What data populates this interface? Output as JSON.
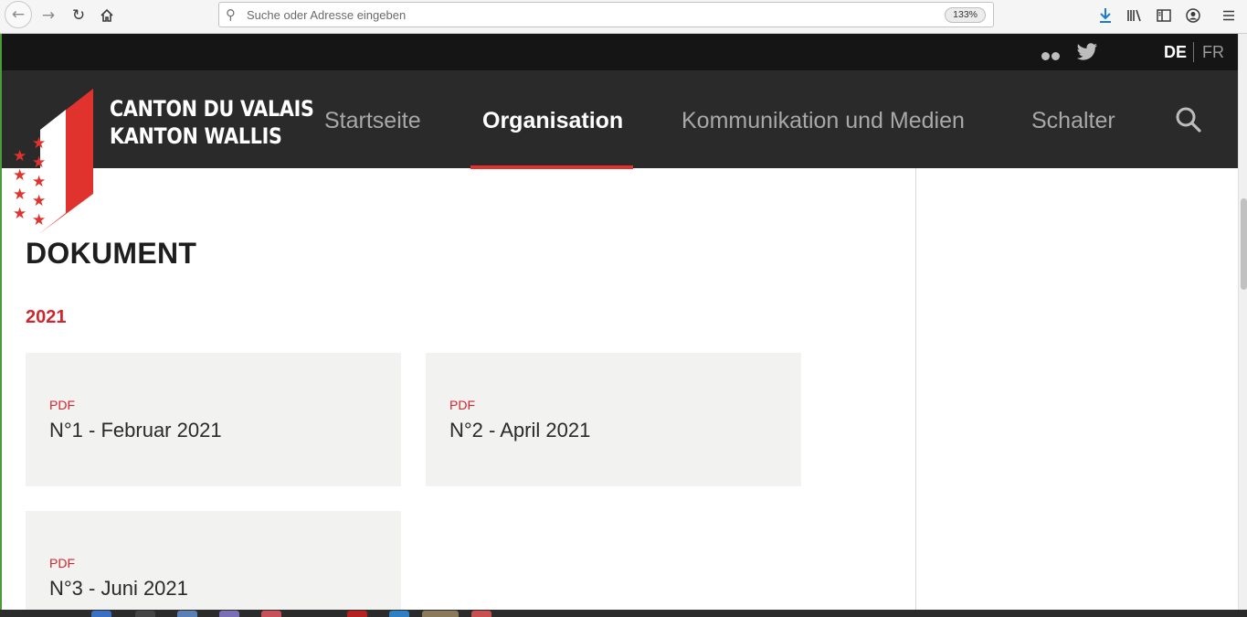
{
  "browser": {
    "url_placeholder": "Suche oder Adresse eingeben",
    "zoom": "133%",
    "icons": [
      "back-icon",
      "forward-icon",
      "reload-icon",
      "home-icon",
      "search-icon",
      "download-icon",
      "library-icon",
      "sidebar-icon",
      "account-icon",
      "menu-icon"
    ]
  },
  "site": {
    "topbar": {
      "social_icons": [
        "flickr-icon",
        "twitter-icon"
      ],
      "lang_active": "DE",
      "lang_other": "FR"
    },
    "logo": {
      "line1": "CANTON DU VALAIS",
      "line2": "KANTON WALLIS"
    },
    "nav": {
      "items": [
        "Startseite",
        "Organisation",
        "Kommunikation und Medien",
        "Schalter"
      ],
      "active": "Organisation"
    },
    "main": {
      "title": "DOKUMENT",
      "year": "2021",
      "documents": [
        {
          "type": "PDF",
          "title": "N°1 - Februar 2021"
        },
        {
          "type": "PDF",
          "title": "N°2 - April 2021"
        },
        {
          "type": "PDF",
          "title": "N°3 - Juni 2021"
        }
      ]
    }
  },
  "colors": {
    "accent_red": "#d0272e",
    "nav_bg": "#2a2a2a",
    "topbar_bg": "#151515",
    "card_bg": "#f2f2f1"
  }
}
